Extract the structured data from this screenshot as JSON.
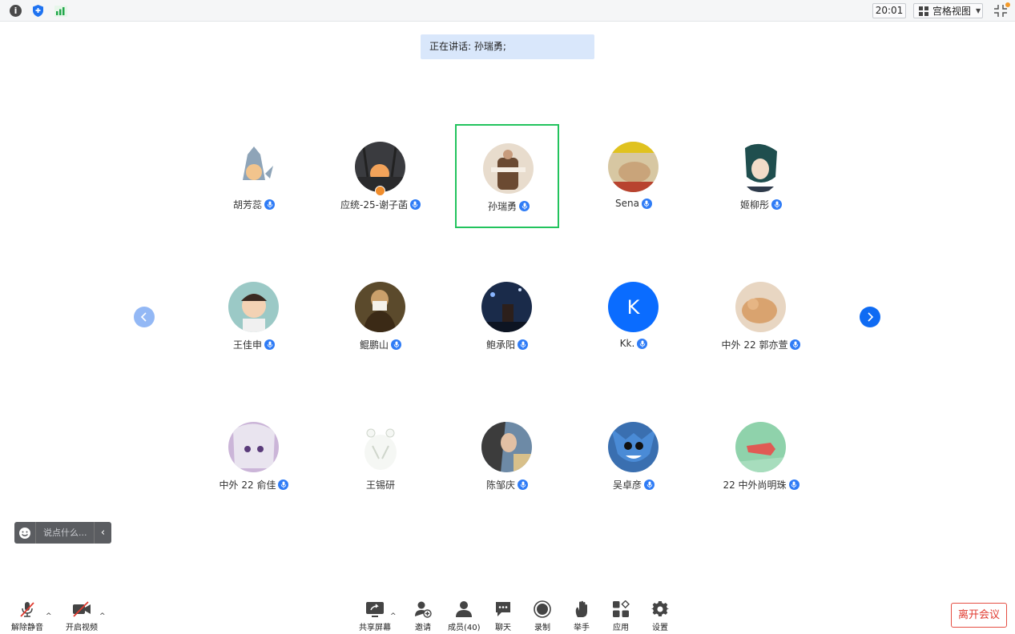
{
  "topbar": {
    "time": "20:01",
    "view_mode": "宫格视图"
  },
  "banner": {
    "speaking_text": "正在讲话: 孙瑞勇;"
  },
  "participants": [
    {
      "name": "胡芳蕊",
      "mic": true
    },
    {
      "name": "应统-25-谢子菡",
      "mic": true,
      "host": true
    },
    {
      "name": "孙瑞勇",
      "mic": true,
      "speaking": true
    },
    {
      "name": "Sena",
      "mic": true
    },
    {
      "name": "姬柳彤",
      "mic": true
    },
    {
      "name": "王佳申",
      "mic": true
    },
    {
      "name": "鲲鹏山",
      "mic": true
    },
    {
      "name": "鲍承阳",
      "mic": true
    },
    {
      "name": "Kk.",
      "mic": true,
      "initial": "K"
    },
    {
      "name": "中外 22 郭亦萱",
      "mic": true
    },
    {
      "name": "中外 22 俞佳",
      "mic": true
    },
    {
      "name": "王锡研",
      "mic": false
    },
    {
      "name": "陈邹庆",
      "mic": true
    },
    {
      "name": "吴卓彦",
      "mic": true
    },
    {
      "name": "22 中外尚明珠",
      "mic": true
    }
  ],
  "chat": {
    "placeholder": "说点什么..."
  },
  "toolbar": {
    "unmute": "解除静音",
    "start_video": "开启视频",
    "share_screen": "共享屏幕",
    "invite": "邀请",
    "members": "成员(40)",
    "chat": "聊天",
    "record": "录制",
    "raise_hand": "举手",
    "apps": "应用",
    "settings": "设置",
    "leave": "离开会议"
  },
  "colors": {
    "accent": "#0f6bf3",
    "speaking_border": "#22c35d",
    "leave": "#e03a2f",
    "banner": "#d9e7fb"
  }
}
